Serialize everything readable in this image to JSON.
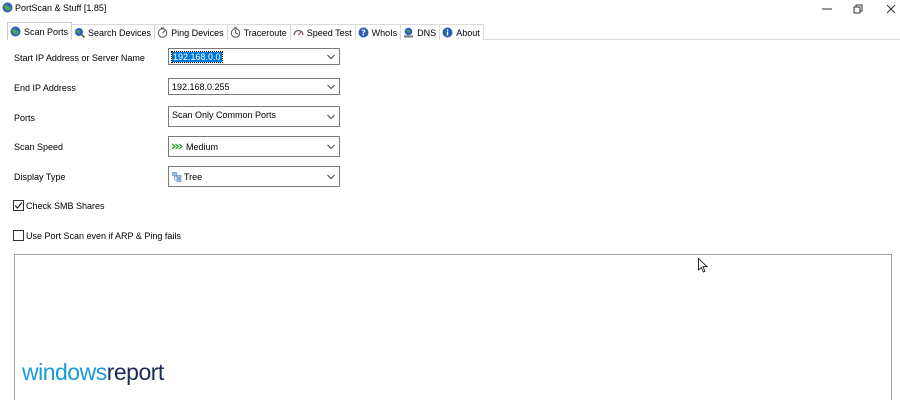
{
  "window": {
    "title": "PortScan & Stuff [1.85]"
  },
  "tabs": [
    {
      "label": "Scan Ports",
      "icon": "globe-icon",
      "active": true
    },
    {
      "label": "Search Devices",
      "icon": "search-globe-icon",
      "active": false
    },
    {
      "label": "Ping Devices",
      "icon": "ping-icon",
      "active": false
    },
    {
      "label": "Traceroute",
      "icon": "traceroute-icon",
      "active": false
    },
    {
      "label": "Speed Test",
      "icon": "speedometer-icon",
      "active": false
    },
    {
      "label": "WhoIs",
      "icon": "question-icon",
      "active": false
    },
    {
      "label": "DNS",
      "icon": "dns-icon",
      "active": false
    },
    {
      "label": "About",
      "icon": "info-icon",
      "active": false
    }
  ],
  "form": {
    "start_ip": {
      "label": "Start IP Address or Server Name",
      "value": "192.168.0.0"
    },
    "end_ip": {
      "label": "End IP Address",
      "value": "192.168.0.255"
    },
    "ports": {
      "label": "Ports",
      "value": "Scan Only Common Ports"
    },
    "scan_speed": {
      "label": "Scan Speed",
      "value": "Medium",
      "icon": "speed-arrows-icon"
    },
    "display_type": {
      "label": "Display Type",
      "value": "Tree",
      "icon": "tree-icon"
    },
    "check_smb": {
      "label": "Check SMB Shares",
      "checked": true
    },
    "use_port_scan": {
      "label": "Use Port Scan even if ARP & Ping fails",
      "checked": false
    }
  },
  "watermark": {
    "part1": "windows",
    "part2": "report"
  },
  "colors": {
    "selection": "#0078d7",
    "watermark_blue": "#1a9ad6",
    "watermark_dark": "#1e2a5a",
    "speed_green": "#2fa02f"
  }
}
